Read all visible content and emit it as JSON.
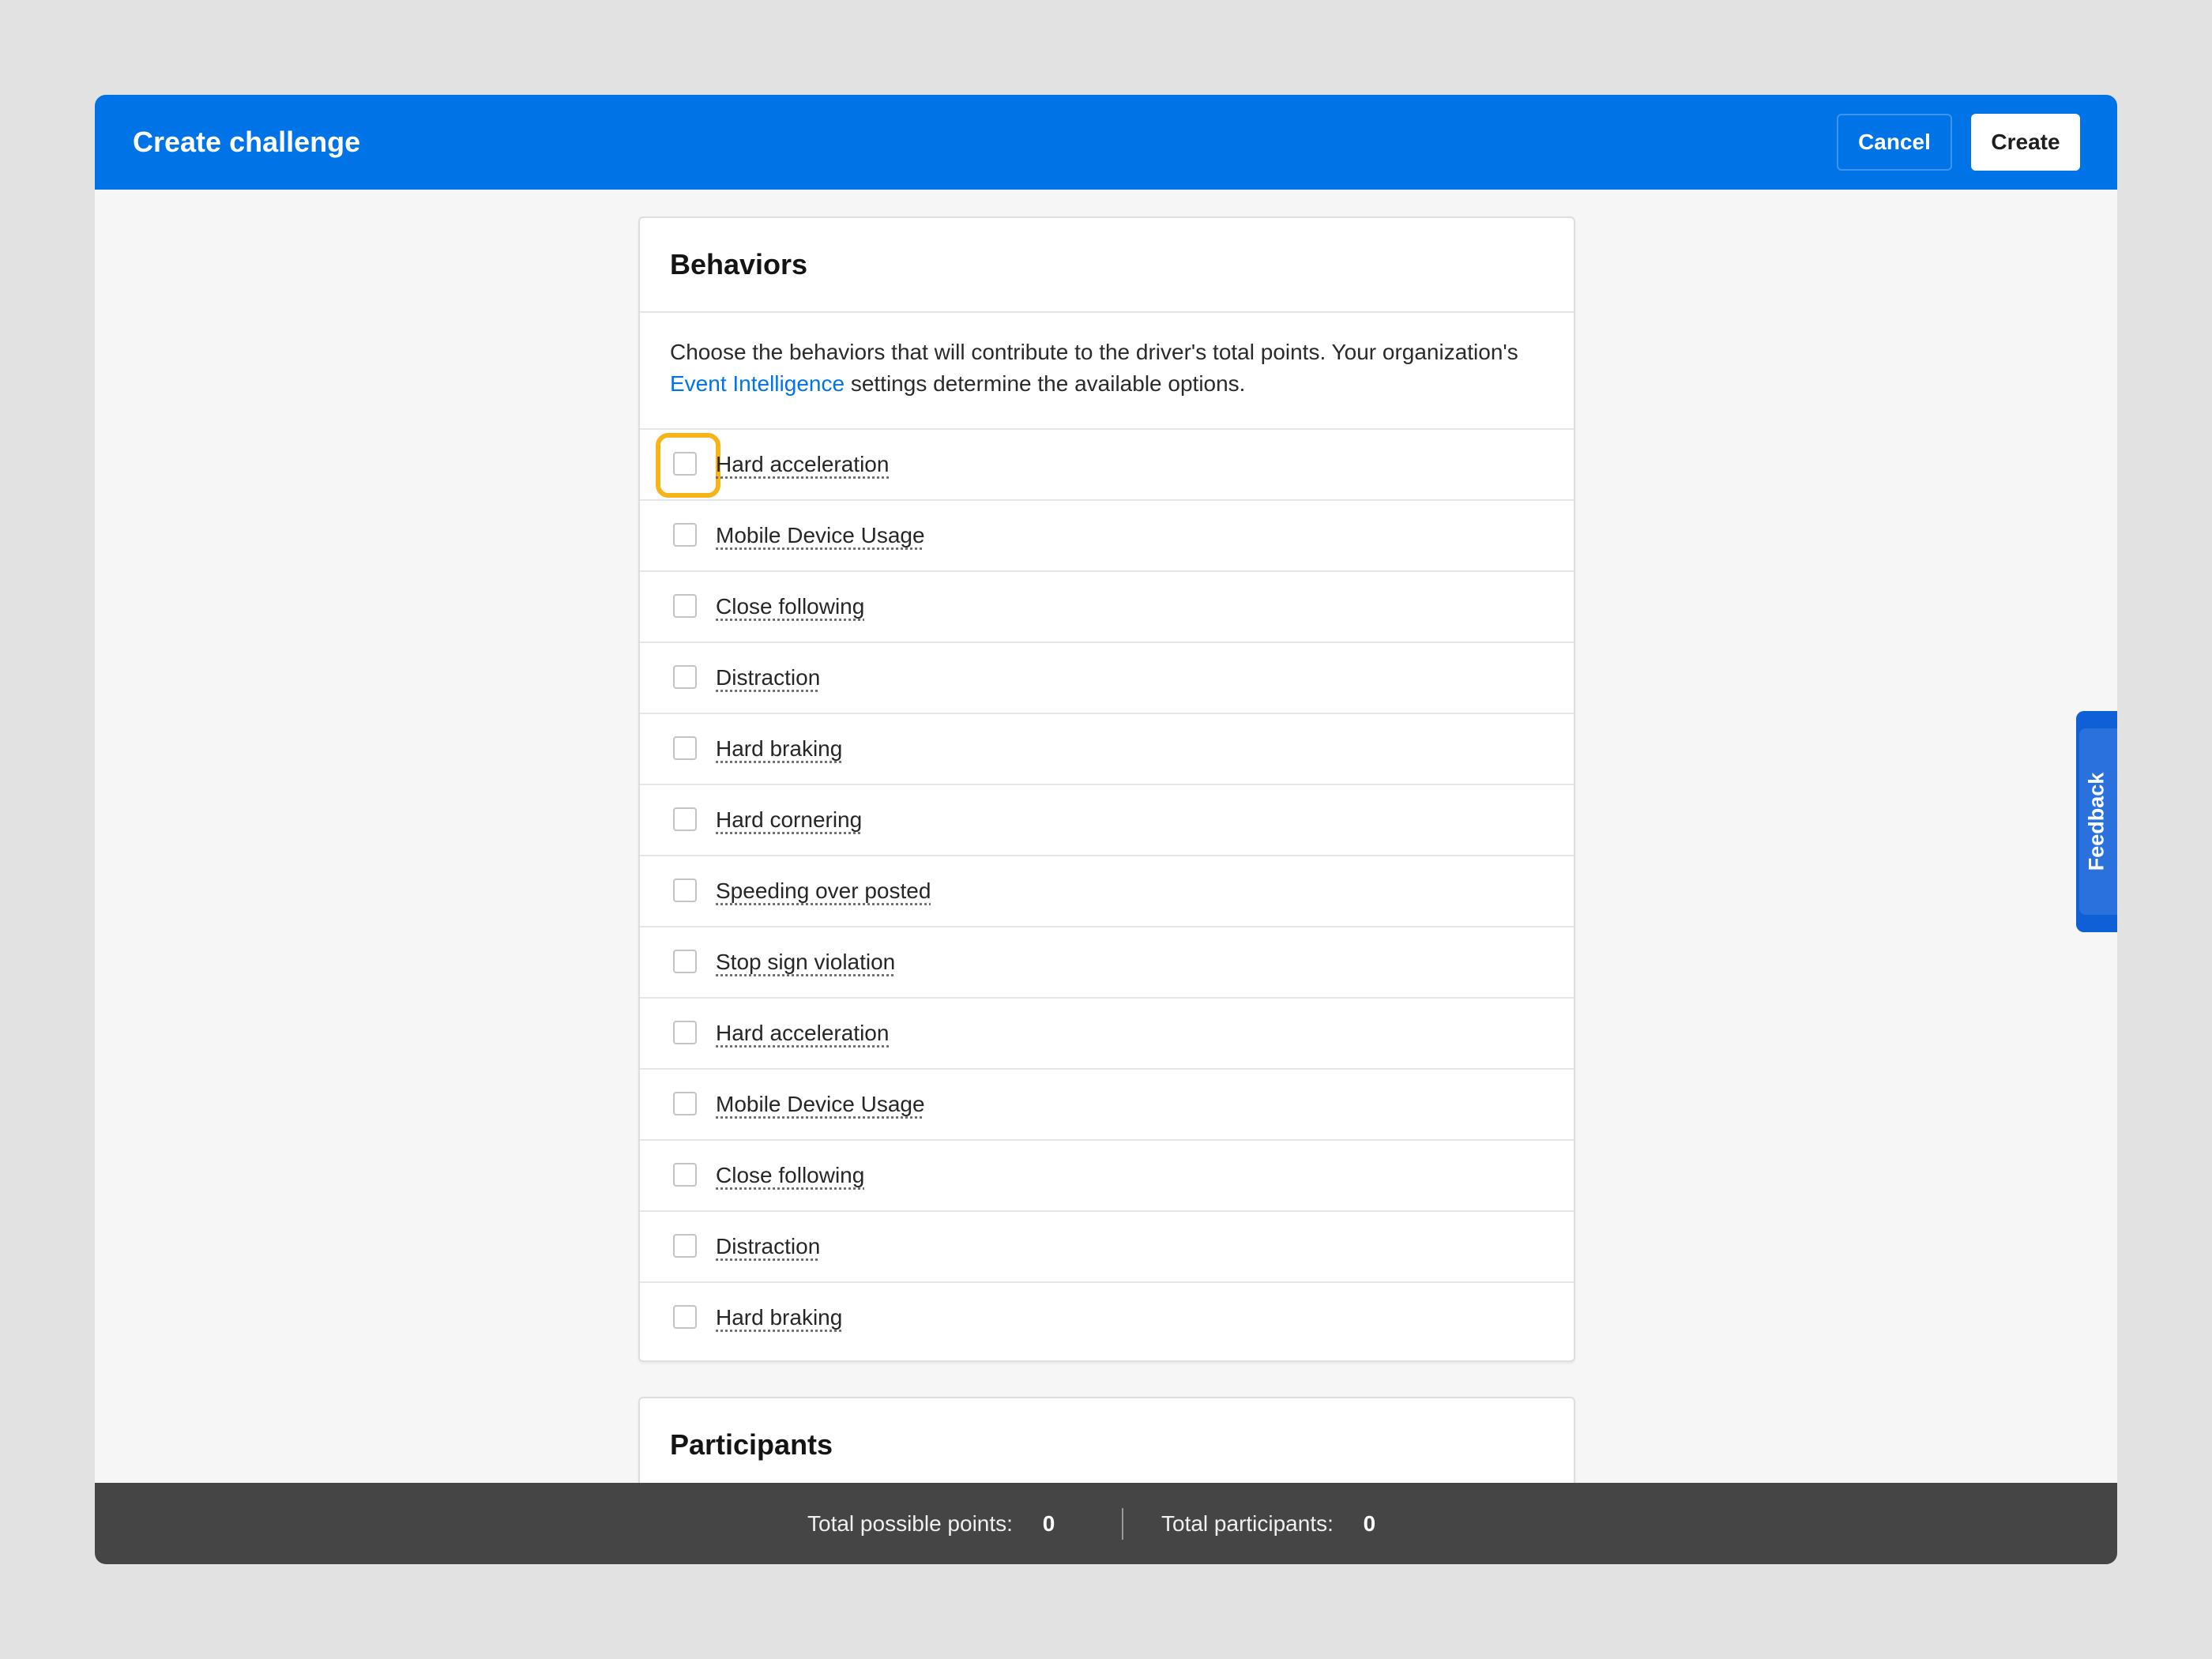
{
  "header": {
    "title": "Create challenge",
    "cancel_label": "Cancel",
    "create_label": "Create"
  },
  "behaviors": {
    "title": "Behaviors",
    "description_before_link": "Choose the behaviors that will contribute to the driver's total points. Your organization's ",
    "link_text": "Event Intelligence",
    "description_after_link": " settings determine the available options.",
    "items": [
      {
        "label": "Hard acceleration",
        "checked": false,
        "focused": true
      },
      {
        "label": "Mobile Device Usage",
        "checked": false
      },
      {
        "label": "Close following",
        "checked": false
      },
      {
        "label": "Distraction",
        "checked": false
      },
      {
        "label": "Hard braking",
        "checked": false
      },
      {
        "label": "Hard cornering",
        "checked": false
      },
      {
        "label": "Speeding over posted",
        "checked": false
      },
      {
        "label": "Stop sign violation",
        "checked": false
      },
      {
        "label": "Hard acceleration",
        "checked": false
      },
      {
        "label": "Mobile Device Usage",
        "checked": false
      },
      {
        "label": "Close following",
        "checked": false
      },
      {
        "label": "Distraction",
        "checked": false
      },
      {
        "label": "Hard braking",
        "checked": false
      }
    ]
  },
  "participants": {
    "title": "Participants"
  },
  "footer": {
    "points_label": "Total possible points:",
    "points_value": "0",
    "participants_label": "Total participants:",
    "participants_value": "0"
  },
  "feedback": {
    "label": "Feedback"
  },
  "colors": {
    "header_bg": "#0073e6",
    "link": "#0073e6",
    "focus_ring": "#f5b519",
    "footer_bg": "#454545",
    "feedback_bg": "#0f5fd6"
  }
}
